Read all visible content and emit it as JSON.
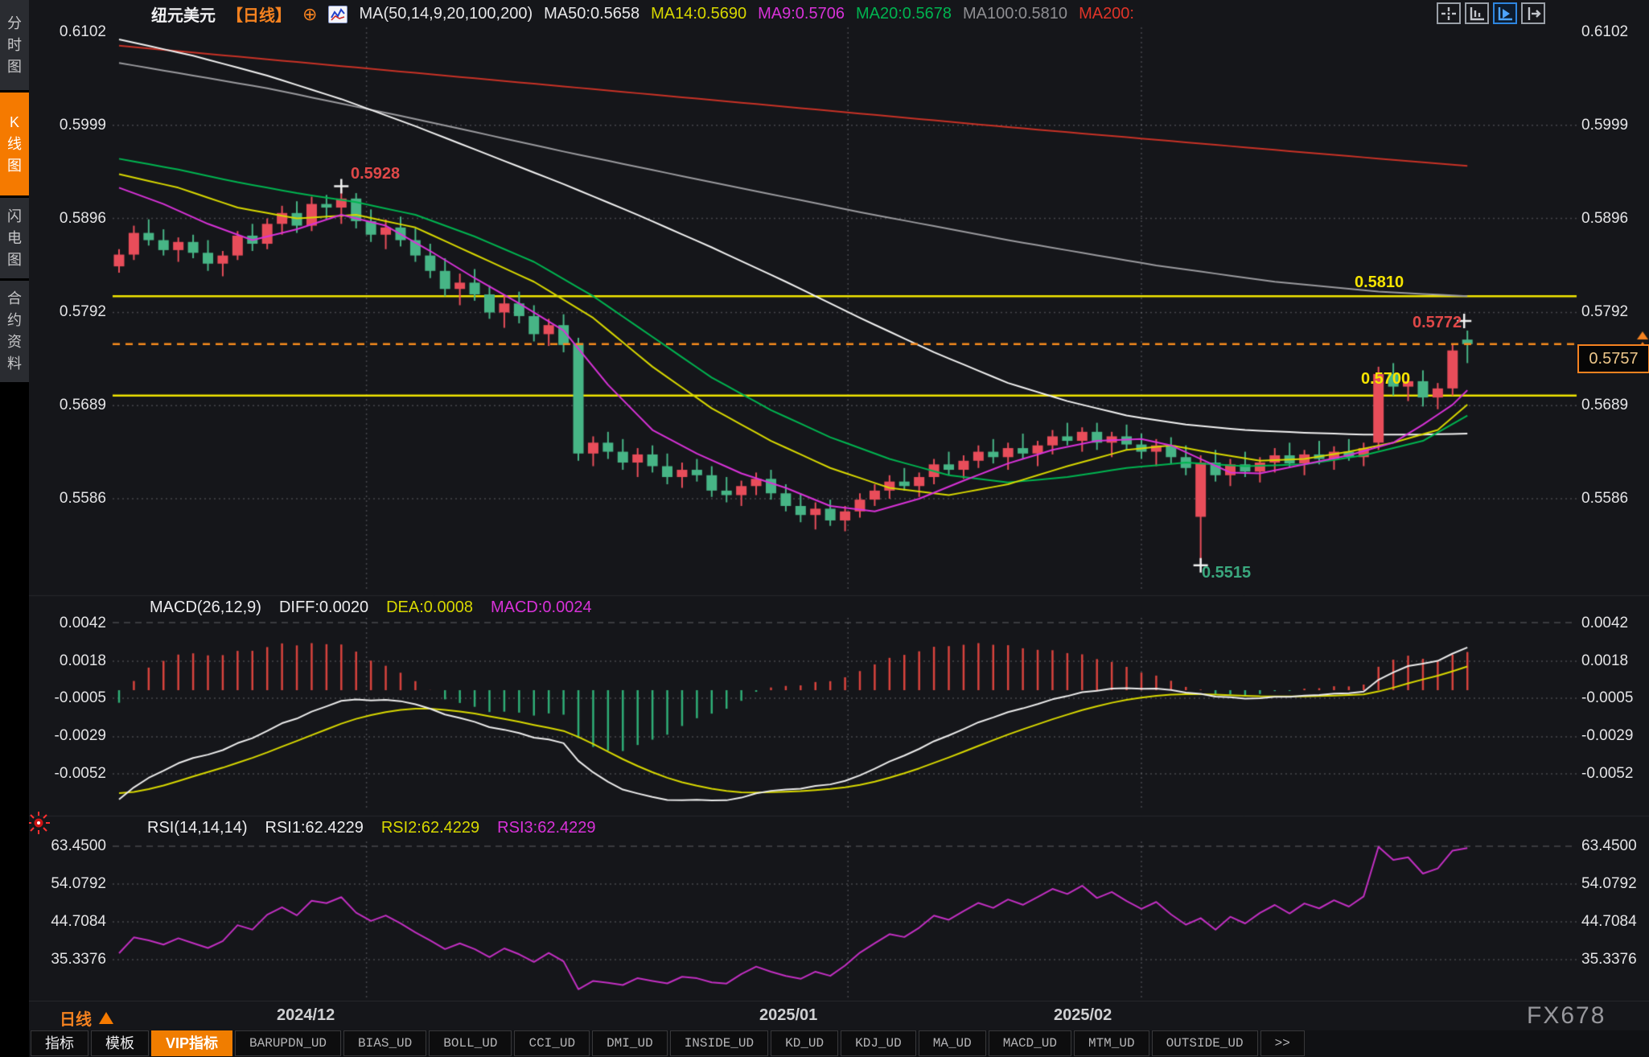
{
  "header": {
    "symbol": "纽元美元",
    "period_tag": "【日线】",
    "target_icon_glyph": "⊕",
    "ma_group_label": "MA(50,14,9,20,100,200)",
    "ma_values": [
      {
        "label": "MA50:0.5658",
        "color": "#e8e8ea"
      },
      {
        "label": "MA14:0.5690",
        "color": "#d8d800"
      },
      {
        "label": "MA9:0.5706",
        "color": "#d832d8"
      },
      {
        "label": "MA20:0.5678",
        "color": "#00b450"
      },
      {
        "label": "MA100:0.5810",
        "color": "#8e8e92"
      },
      {
        "label": "MA200:",
        "color": "#e03428"
      }
    ],
    "view_buttons": [
      "pan-crosshair",
      "axis-scale",
      "auto-follow",
      "shift-chart"
    ]
  },
  "sidebar": {
    "items": [
      {
        "label": "分时图",
        "active": false
      },
      {
        "label": "K线图",
        "active": true
      },
      {
        "label": "闪电图",
        "active": false
      },
      {
        "label": "合约资料",
        "active": false
      }
    ]
  },
  "price_axis": {
    "labels": [
      "0.6102",
      "0.5999",
      "0.5896",
      "0.5792",
      "0.5689",
      "0.5586"
    ]
  },
  "levels": {
    "resistance_label": "0.5810",
    "support_label": "0.5700",
    "last_price_label": "0.5757"
  },
  "annotations": {
    "period_high_label": "0.5928",
    "period_low_label": "0.5515",
    "recent_high_label": "0.5772"
  },
  "macd_panel": {
    "title": "MACD(26,12,9)",
    "diff": "DIFF:0.0020",
    "dea": "DEA:0.0008",
    "macd": "MACD:0.0024",
    "axis": [
      "0.0042",
      "0.0018",
      "-0.0005",
      "-0.0029",
      "-0.0052"
    ]
  },
  "rsi_panel": {
    "title": "RSI(14,14,14)",
    "rsi1": "RSI1:62.4229",
    "rsi2": "RSI2:62.4229",
    "rsi3": "RSI3:62.4229",
    "axis": [
      "63.4500",
      "54.0792",
      "44.7084",
      "35.3376"
    ]
  },
  "timeline": {
    "period_label": "日线",
    "dates": [
      "2024/12",
      "2025/01",
      "2025/02"
    ]
  },
  "bottom_toolbar": {
    "tabs": [
      {
        "label": "指标"
      },
      {
        "label": "模板"
      },
      {
        "label": "VIP指标"
      },
      {
        "label": "BARUPDN_UD"
      },
      {
        "label": "BIAS_UD"
      },
      {
        "label": "BOLL_UD"
      },
      {
        "label": "CCI_UD"
      },
      {
        "label": "DMI_UD"
      },
      {
        "label": "INSIDE_UD"
      },
      {
        "label": "KD_UD"
      },
      {
        "label": "KDJ_UD"
      },
      {
        "label": "MA_UD"
      },
      {
        "label": "MACD_UD"
      },
      {
        "label": "MTM_UD"
      },
      {
        "label": "OUTSIDE_UD"
      },
      {
        "label": ">>"
      }
    ]
  },
  "watermark": "FX678",
  "chart_data": {
    "type": "candlestick",
    "title": "纽元美元 NZD/USD 日线",
    "price_axis_ticks": [
      0.6102,
      0.5999,
      0.5896,
      0.5792,
      0.5689,
      0.5586
    ],
    "levels": {
      "resistance": 0.581,
      "support": 0.57,
      "last_price": 0.5757
    },
    "markers": {
      "period_high": {
        "index": 15,
        "price": 0.5928
      },
      "period_low": {
        "index": 73,
        "price": 0.5515
      },
      "recent_high": {
        "index": 91,
        "price": 0.5772
      }
    },
    "date_ticks": [
      {
        "label": "2024/12",
        "index": 16.7
      },
      {
        "label": "2025/01",
        "index": 49.2
      },
      {
        "label": "2025/02",
        "index": 69.0
      }
    ],
    "candles": [
      [
        0.5843,
        0.5862,
        0.5836,
        0.5856
      ],
      [
        0.5856,
        0.5888,
        0.585,
        0.588
      ],
      [
        0.588,
        0.5895,
        0.5866,
        0.5872
      ],
      [
        0.5872,
        0.5884,
        0.5855,
        0.5861
      ],
      [
        0.5861,
        0.5875,
        0.5848,
        0.587
      ],
      [
        0.587,
        0.5878,
        0.5852,
        0.5858
      ],
      [
        0.5858,
        0.5872,
        0.5838,
        0.5846
      ],
      [
        0.5846,
        0.586,
        0.5832,
        0.5855
      ],
      [
        0.5855,
        0.5882,
        0.585,
        0.5877
      ],
      [
        0.5877,
        0.589,
        0.586,
        0.5868
      ],
      [
        0.5868,
        0.5896,
        0.5862,
        0.589
      ],
      [
        0.589,
        0.591,
        0.5878,
        0.5902
      ],
      [
        0.5902,
        0.5915,
        0.588,
        0.5888
      ],
      [
        0.5888,
        0.592,
        0.5882,
        0.5912
      ],
      [
        0.5912,
        0.5922,
        0.5895,
        0.5908
      ],
      [
        0.5908,
        0.5928,
        0.589,
        0.5918
      ],
      [
        0.5918,
        0.5924,
        0.5885,
        0.5893
      ],
      [
        0.5893,
        0.5906,
        0.587,
        0.5878
      ],
      [
        0.5878,
        0.5895,
        0.5862,
        0.5886
      ],
      [
        0.5886,
        0.5898,
        0.5865,
        0.5872
      ],
      [
        0.5872,
        0.5885,
        0.5848,
        0.5855
      ],
      [
        0.5855,
        0.5868,
        0.583,
        0.5838
      ],
      [
        0.5838,
        0.5852,
        0.581,
        0.5818
      ],
      [
        0.5818,
        0.5835,
        0.58,
        0.5825
      ],
      [
        0.5825,
        0.584,
        0.5805,
        0.5812
      ],
      [
        0.5812,
        0.5822,
        0.5785,
        0.5792
      ],
      [
        0.5792,
        0.581,
        0.5775,
        0.5802
      ],
      [
        0.5802,
        0.5815,
        0.578,
        0.5788
      ],
      [
        0.5788,
        0.58,
        0.576,
        0.5768
      ],
      [
        0.5768,
        0.5785,
        0.5755,
        0.5778
      ],
      [
        0.5778,
        0.579,
        0.5748,
        0.5756
      ],
      [
        0.5758,
        0.5764,
        0.5628,
        0.5636
      ],
      [
        0.5636,
        0.5655,
        0.5622,
        0.5648
      ],
      [
        0.5648,
        0.566,
        0.563,
        0.5638
      ],
      [
        0.5638,
        0.5652,
        0.5618,
        0.5626
      ],
      [
        0.5626,
        0.5642,
        0.561,
        0.5635
      ],
      [
        0.5635,
        0.5645,
        0.5615,
        0.5622
      ],
      [
        0.5622,
        0.5636,
        0.5602,
        0.561
      ],
      [
        0.561,
        0.5626,
        0.5598,
        0.5618
      ],
      [
        0.5618,
        0.563,
        0.5605,
        0.5612
      ],
      [
        0.5612,
        0.5622,
        0.5588,
        0.5595
      ],
      [
        0.5595,
        0.561,
        0.5582,
        0.559
      ],
      [
        0.559,
        0.5606,
        0.5578,
        0.56
      ],
      [
        0.56,
        0.5615,
        0.559,
        0.5608
      ],
      [
        0.5608,
        0.5618,
        0.5585,
        0.5592
      ],
      [
        0.5592,
        0.5602,
        0.5572,
        0.5578
      ],
      [
        0.5578,
        0.5592,
        0.556,
        0.5568
      ],
      [
        0.5568,
        0.5582,
        0.5552,
        0.5575
      ],
      [
        0.5575,
        0.5585,
        0.5556,
        0.5562
      ],
      [
        0.5562,
        0.5578,
        0.555,
        0.5572
      ],
      [
        0.5572,
        0.5592,
        0.5565,
        0.5585
      ],
      [
        0.5585,
        0.5602,
        0.5578,
        0.5595
      ],
      [
        0.5595,
        0.5612,
        0.5586,
        0.5605
      ],
      [
        0.5605,
        0.562,
        0.5595,
        0.56
      ],
      [
        0.56,
        0.5615,
        0.5588,
        0.561
      ],
      [
        0.561,
        0.563,
        0.5602,
        0.5624
      ],
      [
        0.5624,
        0.5638,
        0.5612,
        0.5618
      ],
      [
        0.5618,
        0.5634,
        0.5608,
        0.5628
      ],
      [
        0.5628,
        0.5645,
        0.562,
        0.5638
      ],
      [
        0.5638,
        0.5652,
        0.5625,
        0.5632
      ],
      [
        0.5632,
        0.5648,
        0.5618,
        0.5642
      ],
      [
        0.5642,
        0.5658,
        0.563,
        0.5636
      ],
      [
        0.5636,
        0.565,
        0.5622,
        0.5645
      ],
      [
        0.5645,
        0.5662,
        0.5635,
        0.5655
      ],
      [
        0.5655,
        0.567,
        0.5645,
        0.565
      ],
      [
        0.565,
        0.5665,
        0.5638,
        0.566
      ],
      [
        0.566,
        0.567,
        0.564,
        0.5648
      ],
      [
        0.5648,
        0.566,
        0.5632,
        0.5655
      ],
      [
        0.5655,
        0.5668,
        0.564,
        0.5646
      ],
      [
        0.5646,
        0.5658,
        0.563,
        0.5638
      ],
      [
        0.5638,
        0.5652,
        0.5622,
        0.5645
      ],
      [
        0.5645,
        0.5654,
        0.5625,
        0.5632
      ],
      [
        0.5632,
        0.5645,
        0.5612,
        0.562
      ],
      [
        0.5566,
        0.5634,
        0.5515,
        0.5626
      ],
      [
        0.5626,
        0.564,
        0.5605,
        0.5612
      ],
      [
        0.5612,
        0.563,
        0.56,
        0.5624
      ],
      [
        0.5624,
        0.5638,
        0.561,
        0.5616
      ],
      [
        0.5616,
        0.5632,
        0.5604,
        0.5626
      ],
      [
        0.5626,
        0.5642,
        0.5615,
        0.5634
      ],
      [
        0.5634,
        0.5648,
        0.562,
        0.5625
      ],
      [
        0.5625,
        0.564,
        0.5612,
        0.5635
      ],
      [
        0.5635,
        0.565,
        0.5624,
        0.563
      ],
      [
        0.563,
        0.5644,
        0.5618,
        0.5638
      ],
      [
        0.5638,
        0.5652,
        0.5628,
        0.5632
      ],
      [
        0.5632,
        0.5648,
        0.5622,
        0.5642
      ],
      [
        0.5648,
        0.5732,
        0.564,
        0.5724
      ],
      [
        0.5724,
        0.5736,
        0.57,
        0.571
      ],
      [
        0.571,
        0.5724,
        0.5694,
        0.5716
      ],
      [
        0.5716,
        0.5728,
        0.5688,
        0.5698
      ],
      [
        0.5698,
        0.5714,
        0.5685,
        0.5708
      ],
      [
        0.5708,
        0.5756,
        0.57,
        0.575
      ],
      [
        0.5762,
        0.5772,
        0.5736,
        0.5757
      ]
    ],
    "ma_lines": [
      {
        "name": "MA200",
        "color": "#c83226",
        "points": [
          [
            0,
            0.6087
          ],
          [
            10,
            0.6072
          ],
          [
            20,
            0.6057
          ],
          [
            30,
            0.6042
          ],
          [
            40,
            0.6027
          ],
          [
            50,
            0.6012
          ],
          [
            60,
            0.5997
          ],
          [
            70,
            0.5983
          ],
          [
            80,
            0.5969
          ],
          [
            91,
            0.5954
          ]
        ]
      },
      {
        "name": "MA100",
        "color": "#9a9a9e",
        "points": [
          [
            0,
            0.6068
          ],
          [
            10,
            0.604
          ],
          [
            20,
            0.6006
          ],
          [
            30,
            0.597
          ],
          [
            40,
            0.5936
          ],
          [
            50,
            0.5903
          ],
          [
            60,
            0.5872
          ],
          [
            70,
            0.5844
          ],
          [
            78,
            0.5826
          ],
          [
            85,
            0.5815
          ],
          [
            91,
            0.581
          ]
        ]
      },
      {
        "name": "MA50",
        "color": "#f2f2f2",
        "points": [
          [
            0,
            0.6094
          ],
          [
            5,
            0.6076
          ],
          [
            10,
            0.6054
          ],
          [
            15,
            0.6028
          ],
          [
            20,
            0.5998
          ],
          [
            25,
            0.5966
          ],
          [
            30,
            0.5934
          ],
          [
            35,
            0.59
          ],
          [
            40,
            0.5864
          ],
          [
            45,
            0.5826
          ],
          [
            50,
            0.5786
          ],
          [
            55,
            0.5748
          ],
          [
            60,
            0.5714
          ],
          [
            64,
            0.5694
          ],
          [
            68,
            0.5678
          ],
          [
            72,
            0.5668
          ],
          [
            76,
            0.5662
          ],
          [
            80,
            0.5659
          ],
          [
            84,
            0.5657
          ],
          [
            88,
            0.5657
          ],
          [
            91,
            0.5658
          ]
        ]
      },
      {
        "name": "MA20",
        "color": "#00b450",
        "points": [
          [
            0,
            0.5962
          ],
          [
            4,
            0.595
          ],
          [
            8,
            0.5936
          ],
          [
            12,
            0.5924
          ],
          [
            16,
            0.5914
          ],
          [
            20,
            0.59
          ],
          [
            24,
            0.5876
          ],
          [
            28,
            0.5848
          ],
          [
            32,
            0.581
          ],
          [
            36,
            0.5765
          ],
          [
            40,
            0.572
          ],
          [
            44,
            0.5684
          ],
          [
            48,
            0.5654
          ],
          [
            52,
            0.563
          ],
          [
            56,
            0.5612
          ],
          [
            60,
            0.5604
          ],
          [
            64,
            0.561
          ],
          [
            68,
            0.562
          ],
          [
            72,
            0.5626
          ],
          [
            76,
            0.5622
          ],
          [
            80,
            0.5624
          ],
          [
            84,
            0.5634
          ],
          [
            88,
            0.565
          ],
          [
            91,
            0.5678
          ]
        ]
      },
      {
        "name": "MA14",
        "color": "#d8d800",
        "points": [
          [
            0,
            0.5945
          ],
          [
            4,
            0.593
          ],
          [
            8,
            0.5908
          ],
          [
            12,
            0.5896
          ],
          [
            16,
            0.59
          ],
          [
            20,
            0.5886
          ],
          [
            24,
            0.5856
          ],
          [
            28,
            0.5826
          ],
          [
            32,
            0.5786
          ],
          [
            36,
            0.5732
          ],
          [
            40,
            0.5686
          ],
          [
            44,
            0.565
          ],
          [
            48,
            0.562
          ],
          [
            52,
            0.5598
          ],
          [
            56,
            0.559
          ],
          [
            60,
            0.5602
          ],
          [
            64,
            0.5622
          ],
          [
            68,
            0.564
          ],
          [
            71,
            0.5645
          ],
          [
            74,
            0.5636
          ],
          [
            77,
            0.5628
          ],
          [
            80,
            0.563
          ],
          [
            83,
            0.5638
          ],
          [
            86,
            0.5648
          ],
          [
            89,
            0.5662
          ],
          [
            91,
            0.569
          ]
        ]
      },
      {
        "name": "MA9",
        "color": "#d832d8",
        "points": [
          [
            0,
            0.593
          ],
          [
            3,
            0.5912
          ],
          [
            6,
            0.589
          ],
          [
            9,
            0.5872
          ],
          [
            12,
            0.5884
          ],
          [
            15,
            0.59
          ],
          [
            18,
            0.5888
          ],
          [
            21,
            0.586
          ],
          [
            24,
            0.583
          ],
          [
            27,
            0.5802
          ],
          [
            30,
            0.5772
          ],
          [
            33,
            0.5712
          ],
          [
            36,
            0.5662
          ],
          [
            39,
            0.5636
          ],
          [
            42,
            0.5614
          ],
          [
            45,
            0.5598
          ],
          [
            48,
            0.5578
          ],
          [
            51,
            0.5572
          ],
          [
            54,
            0.5586
          ],
          [
            57,
            0.5606
          ],
          [
            60,
            0.5625
          ],
          [
            63,
            0.564
          ],
          [
            66,
            0.565
          ],
          [
            69,
            0.5652
          ],
          [
            71,
            0.5645
          ],
          [
            73,
            0.563
          ],
          [
            75,
            0.5615
          ],
          [
            77,
            0.5614
          ],
          [
            80,
            0.5624
          ],
          [
            83,
            0.5634
          ],
          [
            86,
            0.5648
          ],
          [
            88,
            0.5668
          ],
          [
            90,
            0.569
          ],
          [
            91,
            0.5706
          ]
        ]
      }
    ],
    "macd": {
      "params": [
        26,
        12,
        9
      ],
      "diff": 0.002,
      "dea": 0.0008,
      "macd": 0.0024,
      "axis_ticks": [
        0.0042,
        0.0018,
        -0.0005,
        -0.0029,
        -0.0052
      ],
      "colors": {
        "positive": "#d8433d",
        "negative": "#2fae76",
        "diff_line": "#ececec",
        "dea_line": "#d8d800"
      }
    },
    "rsi": {
      "params": [
        14,
        14,
        14
      ],
      "rsi1": 62.4229,
      "rsi2": 62.4229,
      "rsi3": 62.4229,
      "axis_ticks": [
        63.45,
        54.0792,
        44.7084,
        35.3376
      ],
      "line_color": "#c22fc2",
      "display_range": [
        28,
        63.3
      ]
    }
  }
}
